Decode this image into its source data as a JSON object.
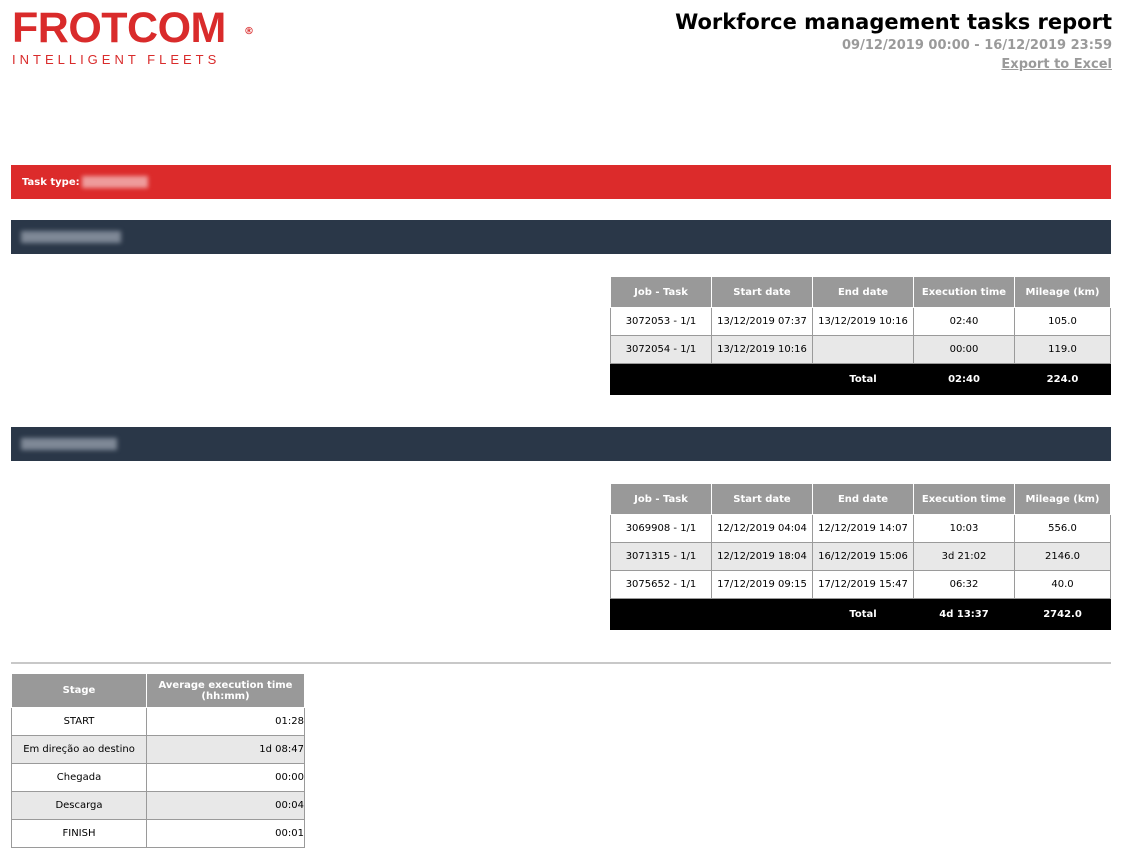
{
  "brand": {
    "name": "FROTCOM",
    "registered": "®",
    "tagline": "INTELLIGENT FLEETS",
    "color": "#dc2b2b"
  },
  "header": {
    "title": "Workforce management tasks report",
    "date_range": "09/12/2019 00:00 - 16/12/2019 23:59",
    "export_label": "Export to Excel"
  },
  "task_type": {
    "label": "Task type:"
  },
  "columns": [
    "Job - Task",
    "Start date",
    "End date",
    "Execution time",
    "Mileage (km)"
  ],
  "groups": [
    {
      "rows": [
        [
          "3072053 - 1/1",
          "13/12/2019 07:37",
          "13/12/2019 10:16",
          "02:40",
          "105.0"
        ],
        [
          "3072054 - 1/1",
          "13/12/2019 10:16",
          "",
          "00:00",
          "119.0"
        ]
      ],
      "total": {
        "label": "Total",
        "execution_time": "02:40",
        "mileage": "224.0"
      }
    },
    {
      "rows": [
        [
          "3069908 - 1/1",
          "12/12/2019 04:04",
          "12/12/2019 14:07",
          "10:03",
          "556.0"
        ],
        [
          "3071315 - 1/1",
          "12/12/2019 18:04",
          "16/12/2019 15:06",
          "3d 21:02",
          "2146.0"
        ],
        [
          "3075652 - 1/1",
          "17/12/2019 09:15",
          "17/12/2019 15:47",
          "06:32",
          "40.0"
        ]
      ],
      "total": {
        "label": "Total",
        "execution_time": "4d 13:37",
        "mileage": "2742.0"
      }
    }
  ],
  "stages": {
    "columns": [
      "Stage",
      "Average execution time (hh:mm)"
    ],
    "rows": [
      [
        "START",
        "01:28"
      ],
      [
        "Em direção ao destino",
        "1d 08:47"
      ],
      [
        "Chegada",
        "00:00"
      ],
      [
        "Descarga",
        "00:04"
      ],
      [
        "FINISH",
        "00:01"
      ]
    ]
  },
  "colors": {
    "header_gray": "#999999",
    "group_bar": "#2a3748",
    "total_row": "#000000",
    "alt_row": "#e8e8e8"
  }
}
